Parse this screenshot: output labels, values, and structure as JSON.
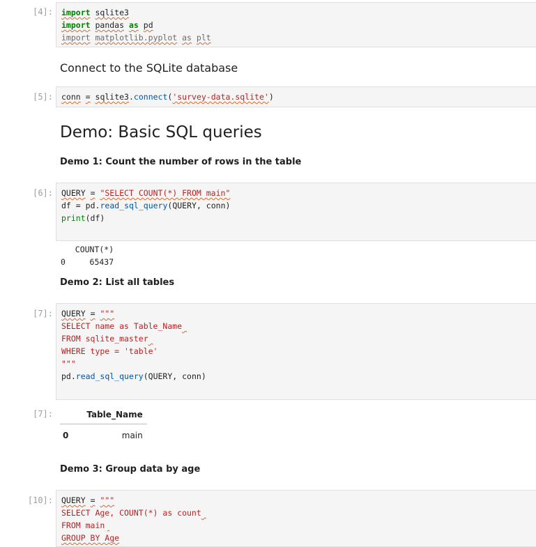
{
  "cells": {
    "c4": {
      "prompt": "[4]:"
    },
    "md_connect": {
      "text": "Connect to the SQLite database"
    },
    "c5": {
      "prompt": "[5]:"
    },
    "md_demo": {
      "text": "Demo: Basic SQL queries"
    },
    "md_demo1": {
      "text": "Demo 1: Count the number of rows in the table"
    },
    "c6": {
      "prompt": "[6]:",
      "output": "   COUNT(*)\n0     65437"
    },
    "md_demo2": {
      "text": "Demo 2: List all tables"
    },
    "c7": {
      "prompt": "[7]:"
    },
    "o7": {
      "prompt": "[7]:",
      "header": "Table_Name",
      "index": "0",
      "value": "main"
    },
    "md_demo3": {
      "text": "Demo 3: Group data by age"
    },
    "c10": {
      "prompt": "[10]:"
    }
  },
  "tokens": {
    "t_import": "import",
    "t_sqlite3": "sqlite3",
    "t_pandas": "pandas",
    "t_as": "as",
    "t_pd": "pd",
    "t_mpl": "matplotlib.pyplot",
    "t_plt": "plt",
    "t_conn": "conn",
    "t_eq": "=",
    "t_sqlite3_mod": "sqlite3",
    "t_dot": ".",
    "t_connect": "connect",
    "t_lp": "(",
    "t_file": "'survey-data.sqlite'",
    "t_rp": ")",
    "t_query": "QUERY",
    "t_count_str": "\"SELECT COUNT(*) FROM main\"",
    "t_df": "df",
    "t_read_sql": "read_sql_query",
    "t_args": "(QUERY, conn)",
    "t_print": "print",
    "t_dfarg": "(df)",
    "t_triple": "\"\"\"",
    "t_sel_name": "SELECT name as Table_Name",
    "t_from_master": "FROM sqlite_master",
    "t_where": "WHERE type = 'table'",
    "t_sel_age": "SELECT Age, COUNT(*) as count",
    "t_from_main": "FROM main",
    "t_group": "GROUP BY Age"
  }
}
